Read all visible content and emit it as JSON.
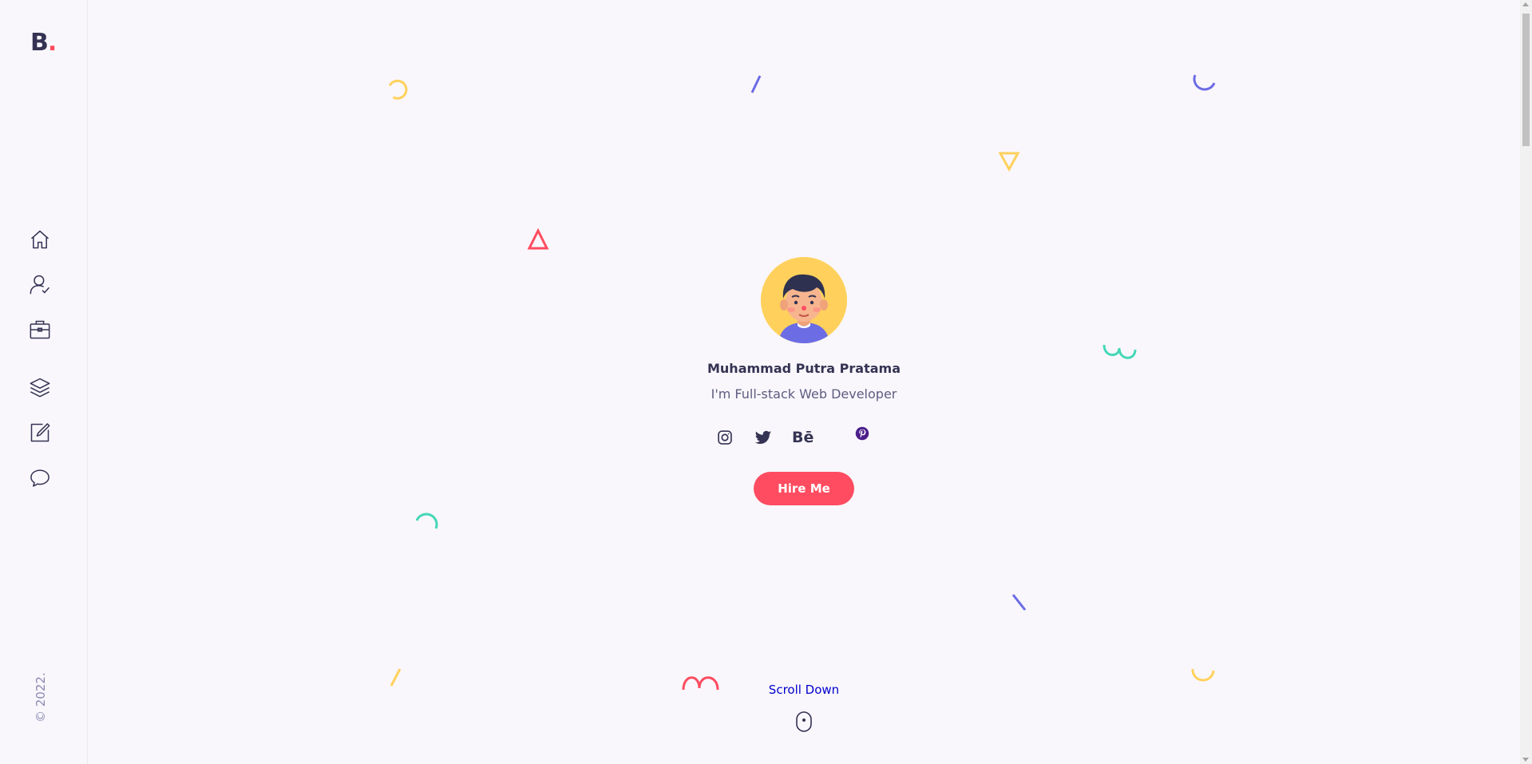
{
  "logo": {
    "letter": "B",
    "dot": "."
  },
  "sidebar": {
    "nav": [
      {
        "name": "nav-home",
        "icon": "home-icon"
      },
      {
        "name": "nav-about",
        "icon": "user-check-icon"
      },
      {
        "name": "nav-services",
        "icon": "briefcase-icon"
      },
      {
        "name": "nav-experience",
        "icon": "layers-icon"
      },
      {
        "name": "nav-works",
        "icon": "edit-icon"
      },
      {
        "name": "nav-contact",
        "icon": "chat-bubble-icon"
      }
    ],
    "copyright": "© 2022."
  },
  "hero": {
    "name": "Muhammad Putra Pratama",
    "subtitle": "I'm Full-stack Web Developer",
    "social": [
      {
        "name": "instagram",
        "icon": "instagram-icon"
      },
      {
        "name": "twitter",
        "icon": "twitter-icon"
      },
      {
        "name": "behance",
        "icon": "behance-icon",
        "text": "Bē"
      },
      {
        "name": "pinterest",
        "icon": "pinterest-icon"
      }
    ],
    "hire_label": "Hire Me",
    "scroll_label": "Scroll Down"
  },
  "colors": {
    "accent": "#ff4c60",
    "yellow": "#ffd15c",
    "purple": "#6c6ce5",
    "teal": "#44d7b6",
    "dark": "#353353",
    "background": "#f9f7fc"
  }
}
